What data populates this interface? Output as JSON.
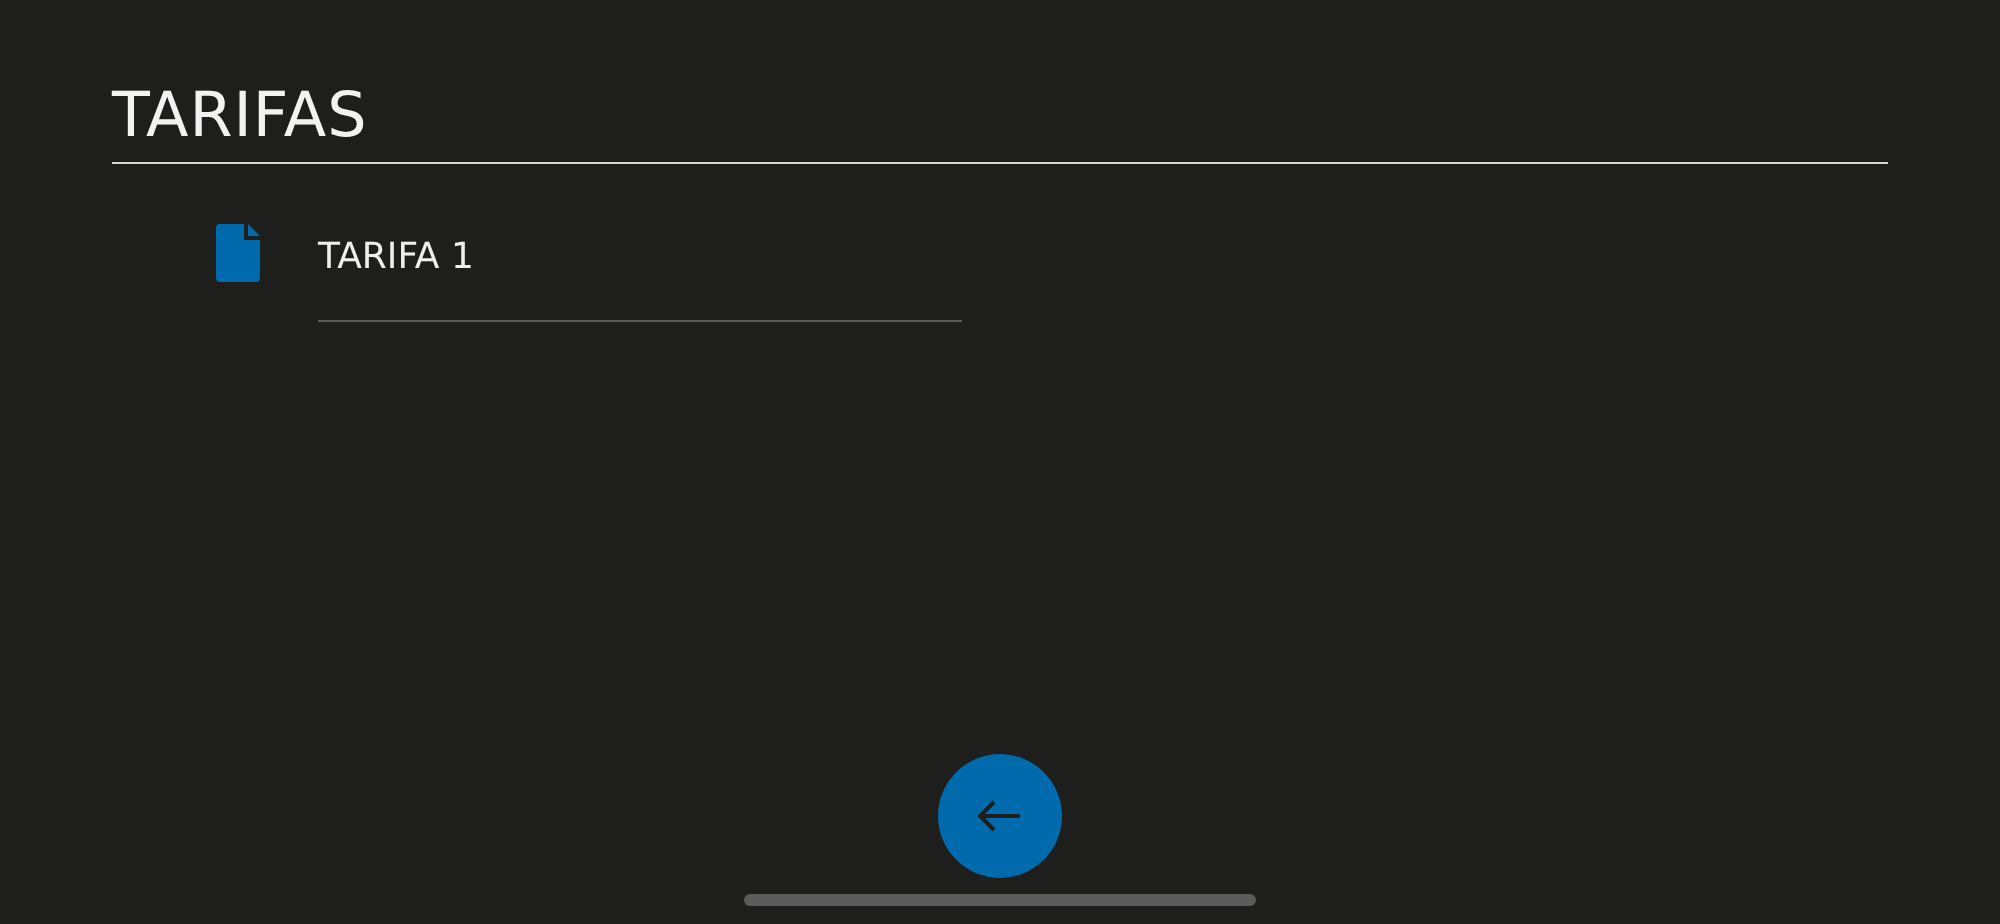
{
  "title": "TARIFAS",
  "items": [
    {
      "label": "TARIFA 1"
    }
  ]
}
